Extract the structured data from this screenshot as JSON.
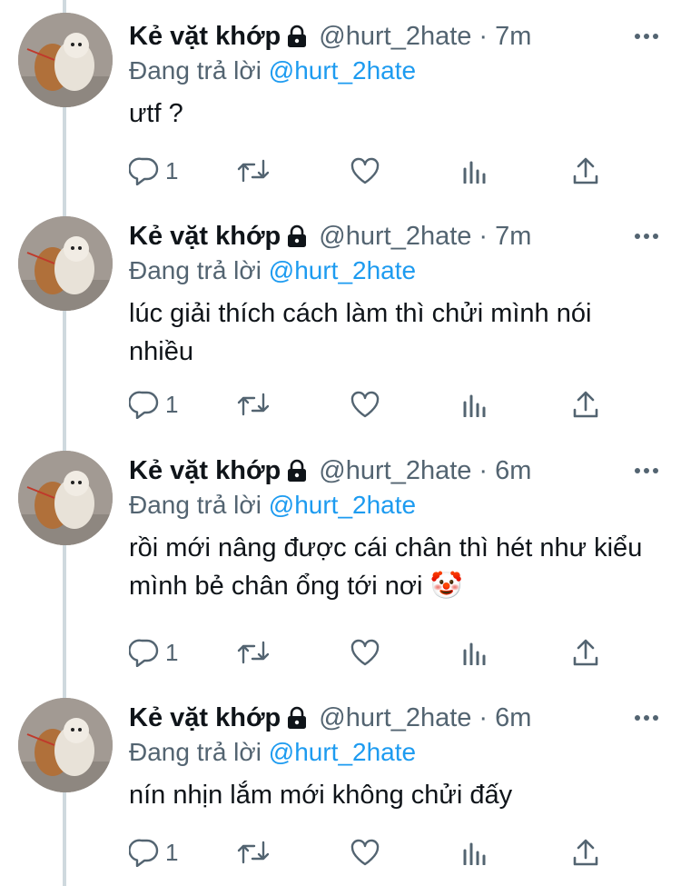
{
  "colors": {
    "text": "#0f1419",
    "secondary": "#536471",
    "link": "#1d9bf0",
    "thread_line": "#cfd9de"
  },
  "tweets": [
    {
      "name": "Kẻ vặt khớp",
      "lock_icon": "lock-icon",
      "handle": "@hurt_2hate",
      "separator": "·",
      "time": "7m",
      "replying_label": "Đang trả lời",
      "replying_to": "@hurt_2hate",
      "text": "ưtf ?",
      "reply_count": "1"
    },
    {
      "name": "Kẻ vặt khớp",
      "lock_icon": "lock-icon",
      "handle": "@hurt_2hate",
      "separator": "·",
      "time": "7m",
      "replying_label": "Đang trả lời",
      "replying_to": "@hurt_2hate",
      "text": "lúc giải thích cách làm thì chửi mình nói nhiều",
      "reply_count": "1"
    },
    {
      "name": "Kẻ vặt khớp",
      "lock_icon": "lock-icon",
      "handle": "@hurt_2hate",
      "separator": "·",
      "time": "6m",
      "replying_label": "Đang trả lời",
      "replying_to": "@hurt_2hate",
      "text": "rồi mới nâng được cái chân thì hét như kiểu mình bẻ chân ổng tới nơi 🤡",
      "reply_count": "1"
    },
    {
      "name": "Kẻ vặt khớp",
      "lock_icon": "lock-icon",
      "handle": "@hurt_2hate",
      "separator": "·",
      "time": "6m",
      "replying_label": "Đang trả lời",
      "replying_to": "@hurt_2hate",
      "text": "nín nhịn lắm mới không chửi đấy",
      "reply_count": "1"
    }
  ]
}
